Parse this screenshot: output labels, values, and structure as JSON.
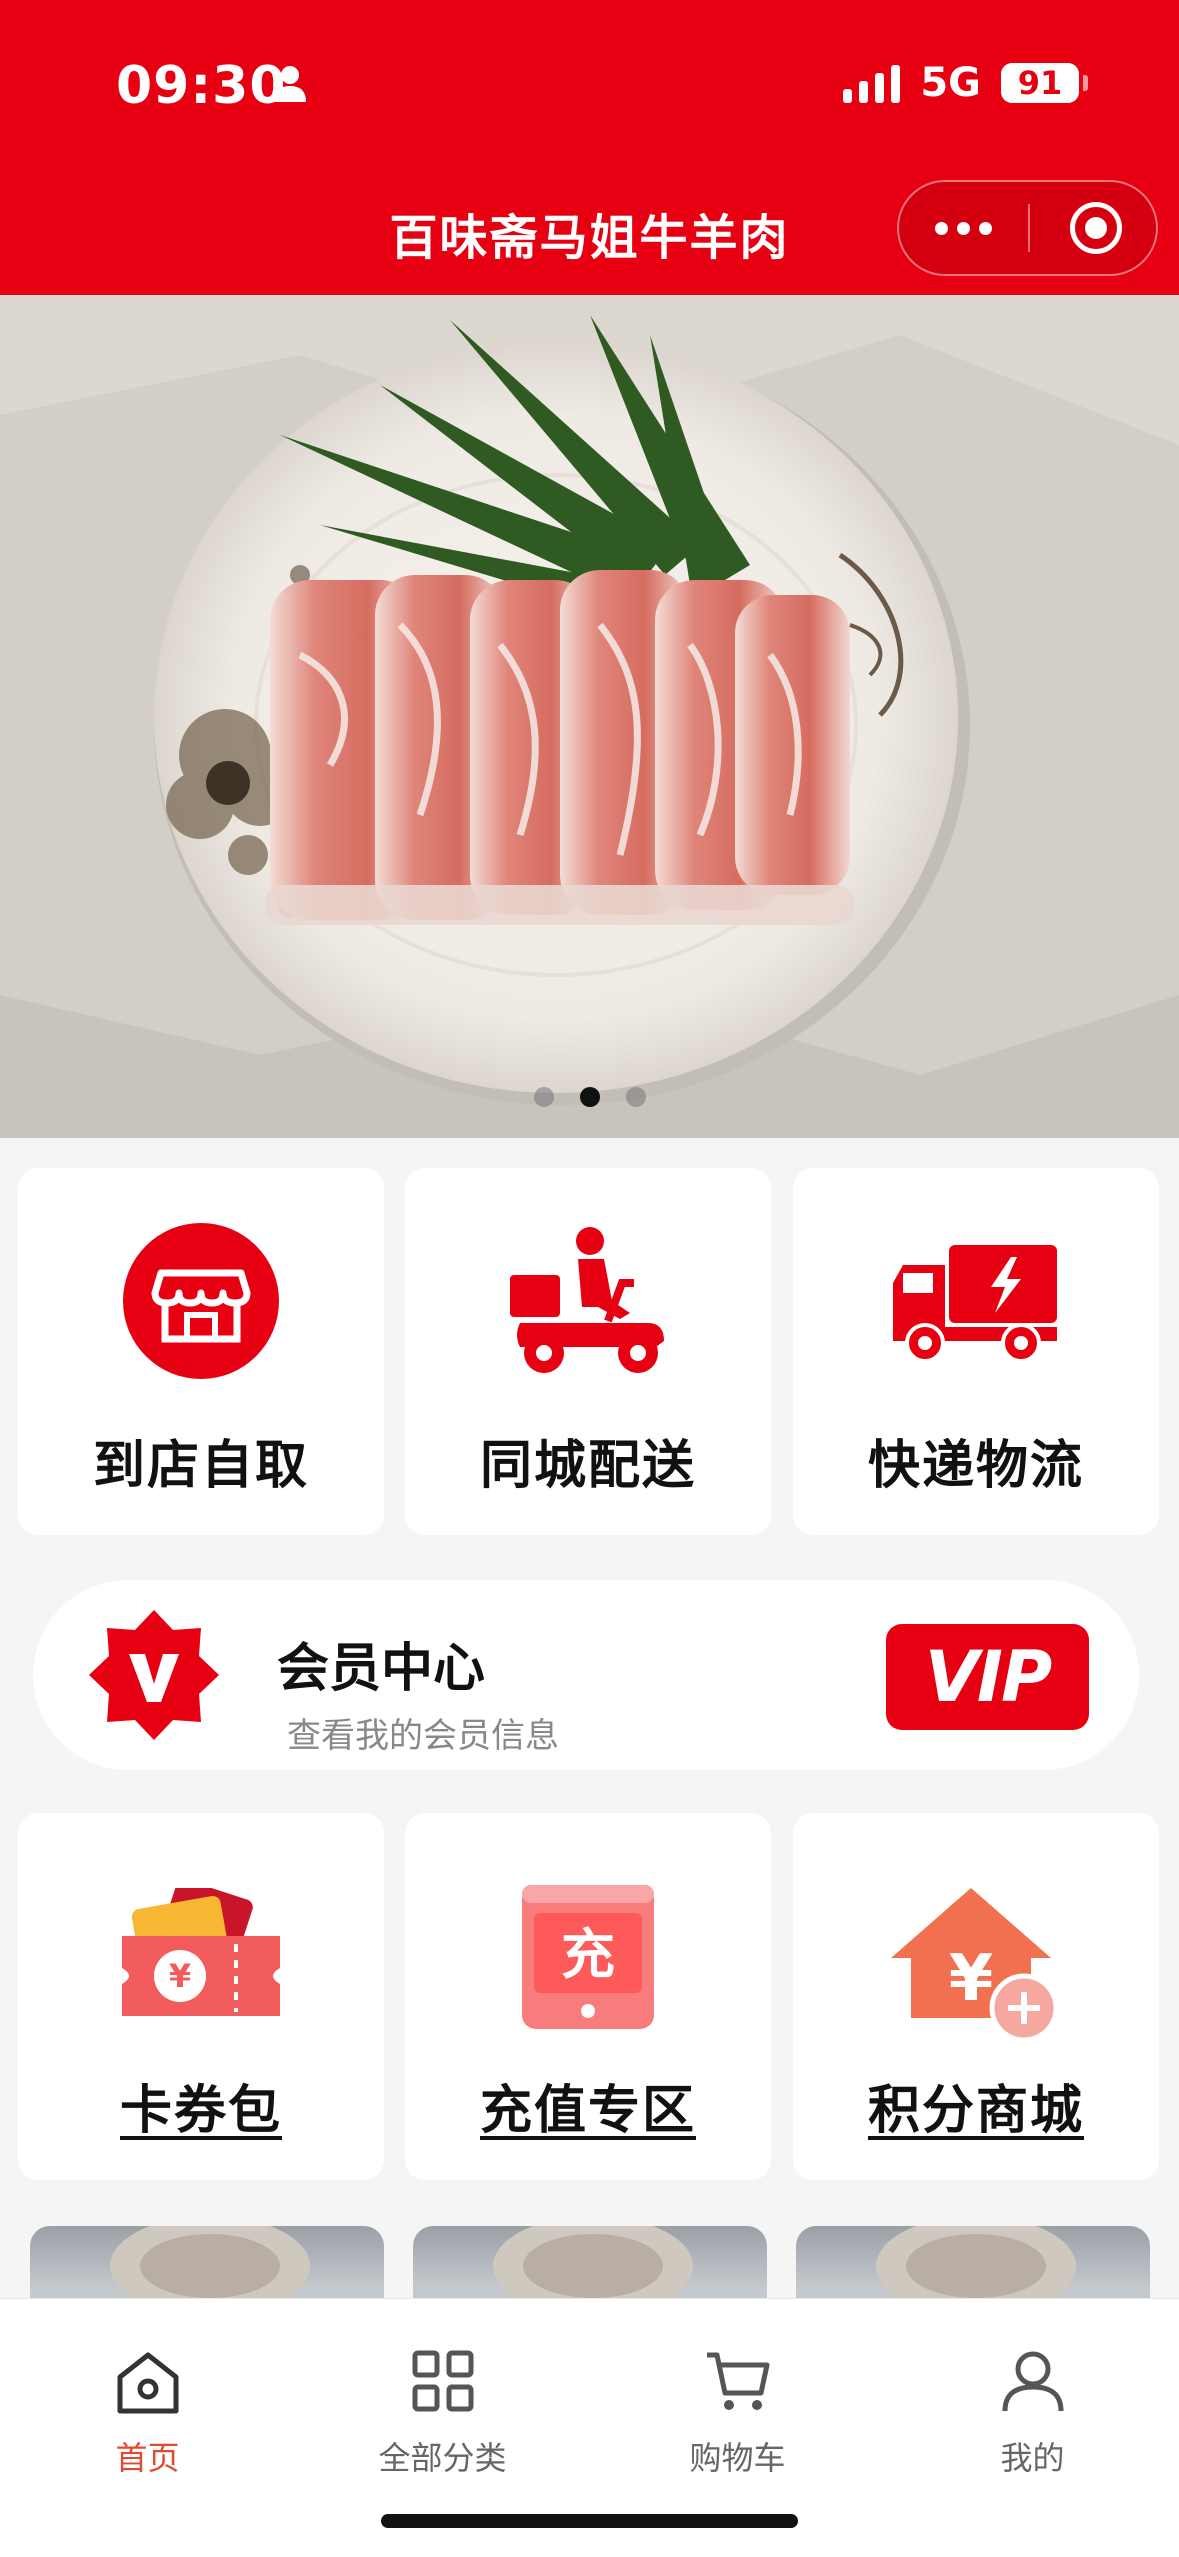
{
  "status": {
    "time": "09:30",
    "network": "5G",
    "battery": "91"
  },
  "app": {
    "title": "百味斋马姐牛羊肉"
  },
  "banner": {
    "slide_count": 3,
    "active_index": 1
  },
  "services": [
    {
      "label": "到店自取",
      "icon": "store-icon"
    },
    {
      "label": "同城配送",
      "icon": "scooter-delivery-icon"
    },
    {
      "label": "快递物流",
      "icon": "truck-icon"
    }
  ],
  "member": {
    "title": "会员中心",
    "subtitle": "查看我的会员信息",
    "badge": "VIP"
  },
  "tools": [
    {
      "label": "卡券包",
      "icon": "coupon-wallet-icon"
    },
    {
      "label": "充值专区",
      "icon": "recharge-icon"
    },
    {
      "label": "积分商城",
      "icon": "points-mall-icon"
    }
  ],
  "tabbar": [
    {
      "label": "首页",
      "icon": "home-icon",
      "active": true
    },
    {
      "label": "全部分类",
      "icon": "grid-icon",
      "active": false
    },
    {
      "label": "购物车",
      "icon": "cart-icon",
      "active": false
    },
    {
      "label": "我的",
      "icon": "user-icon",
      "active": false
    }
  ],
  "colors": {
    "brand": "#e60012",
    "active_tab": "#e04a30",
    "background": "#f5f5f5"
  }
}
